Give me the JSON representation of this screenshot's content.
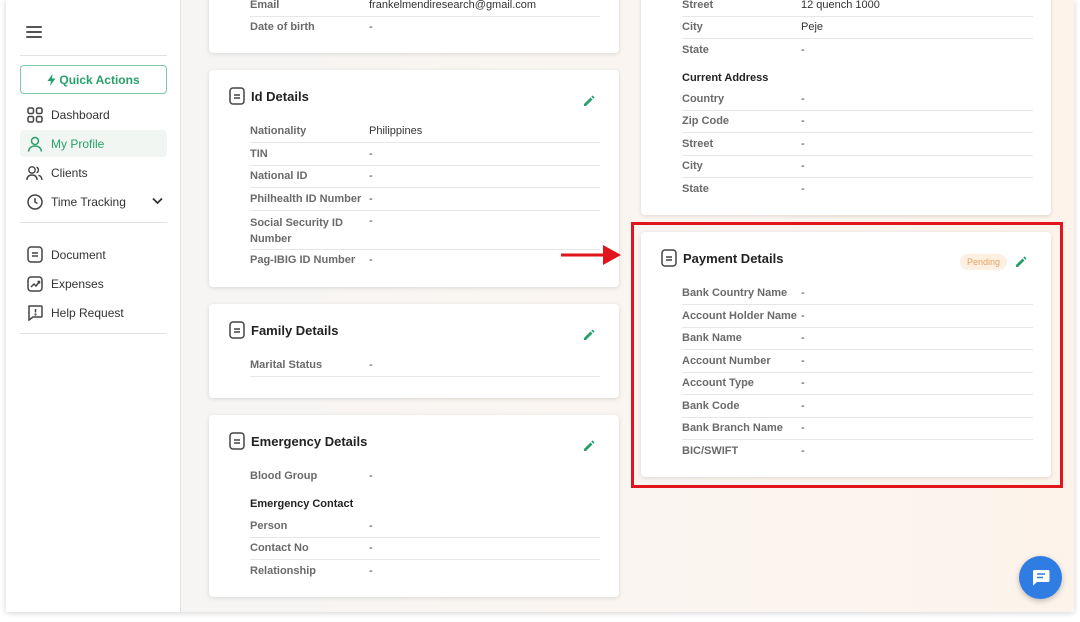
{
  "sidebar": {
    "quick_actions": "Quick Actions",
    "nav": [
      {
        "label": "Dashboard",
        "icon": "grid-icon"
      },
      {
        "label": "My Profile",
        "icon": "user-icon"
      },
      {
        "label": "Clients",
        "icon": "users-icon"
      },
      {
        "label": "Time Tracking",
        "icon": "clock-icon"
      },
      {
        "label": "Document",
        "icon": "document-icon"
      },
      {
        "label": "Expenses",
        "icon": "chart-icon"
      },
      {
        "label": "Help Request",
        "icon": "help-icon"
      }
    ]
  },
  "personal_card": {
    "rows": [
      {
        "label": "Email",
        "value": "frankelmendiresearch@gmail.com"
      },
      {
        "label": "Date of birth",
        "value": "-"
      }
    ]
  },
  "id_card": {
    "title": "Id Details",
    "rows": [
      {
        "label": "Nationality",
        "value": "Philippines"
      },
      {
        "label": "TIN",
        "value": "-"
      },
      {
        "label": "National ID",
        "value": "-"
      },
      {
        "label": "Philhealth ID Number",
        "value": "-"
      },
      {
        "label": "Social Security ID Number",
        "value": "-"
      },
      {
        "label": "Pag-IBIG ID Number",
        "value": "-"
      }
    ]
  },
  "family_card": {
    "title": "Family Details",
    "rows": [
      {
        "label": "Marital Status",
        "value": "-"
      }
    ]
  },
  "emergency_card": {
    "title": "Emergency Details",
    "blood_group": {
      "label": "Blood Group",
      "value": "-"
    },
    "contact_heading": "Emergency Contact",
    "rows": [
      {
        "label": "Person",
        "value": "-"
      },
      {
        "label": "Contact No",
        "value": "-"
      },
      {
        "label": "Relationship",
        "value": "-"
      }
    ]
  },
  "address_card": {
    "permanent_rows": [
      {
        "label": "Street",
        "value": "12 quench 1000"
      },
      {
        "label": "City",
        "value": "Peje"
      },
      {
        "label": "State",
        "value": "-"
      }
    ],
    "current_heading": "Current Address",
    "current_rows": [
      {
        "label": "Country",
        "value": "-"
      },
      {
        "label": "Zip Code",
        "value": "-"
      },
      {
        "label": "Street",
        "value": "-"
      },
      {
        "label": "City",
        "value": "-"
      },
      {
        "label": "State",
        "value": "-"
      }
    ]
  },
  "payment_card": {
    "title": "Payment Details",
    "status": "Pending",
    "rows": [
      {
        "label": "Bank Country Name",
        "value": "-"
      },
      {
        "label": "Account Holder Name",
        "value": "-"
      },
      {
        "label": "Bank Name",
        "value": "-"
      },
      {
        "label": "Account Number",
        "value": "-"
      },
      {
        "label": "Account Type",
        "value": "-"
      },
      {
        "label": "Bank Code",
        "value": "-"
      },
      {
        "label": "Bank Branch Name",
        "value": "-"
      },
      {
        "label": "BIC/SWIFT",
        "value": "-"
      }
    ]
  },
  "colors": {
    "accent_green": "#27a06a",
    "highlight_red": "#e0161c",
    "pending_bg": "#fdf0e3",
    "pending_text": "#e3a160",
    "chat_blue": "#2f7de3"
  }
}
